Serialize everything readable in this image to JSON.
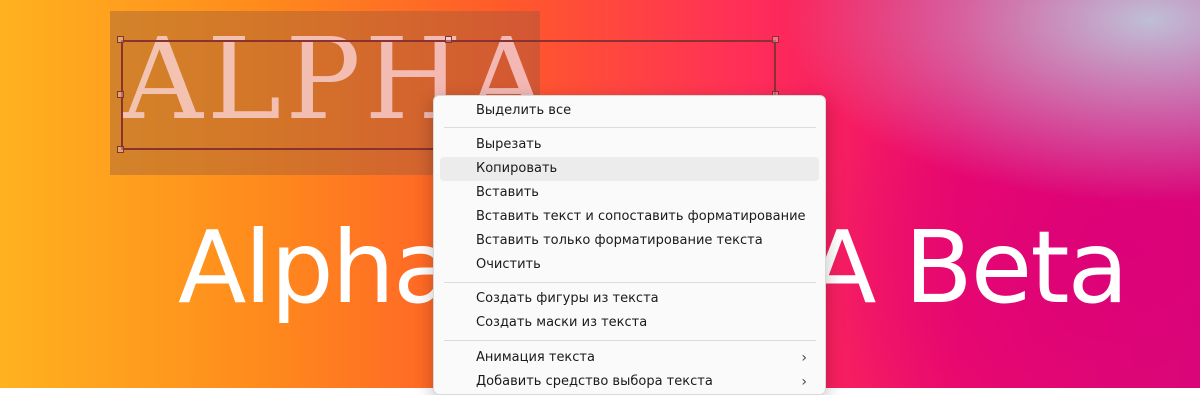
{
  "canvas": {
    "serif_text": "ALPHA",
    "big_text_left": "Alpha",
    "big_text_right": "A Beta"
  },
  "context_menu": {
    "items": [
      {
        "label": "Выделить все",
        "submenu": false
      },
      {
        "label": "Вырезать",
        "submenu": false
      },
      {
        "label": "Копировать",
        "submenu": false,
        "hovered": true
      },
      {
        "label": "Вставить",
        "submenu": false
      },
      {
        "label": "Вставить текст и сопоставить форматирование",
        "submenu": false
      },
      {
        "label": "Вставить только форматирование текста",
        "submenu": false
      },
      {
        "label": "Очистить",
        "submenu": false
      },
      {
        "label": "Создать фигуры из текста",
        "submenu": false
      },
      {
        "label": "Создать маски из текста",
        "submenu": false
      },
      {
        "label": "Анимация текста",
        "submenu": true
      },
      {
        "label": "Добавить средство выбора текста",
        "submenu": true
      }
    ],
    "submenu_glyph": "›"
  }
}
